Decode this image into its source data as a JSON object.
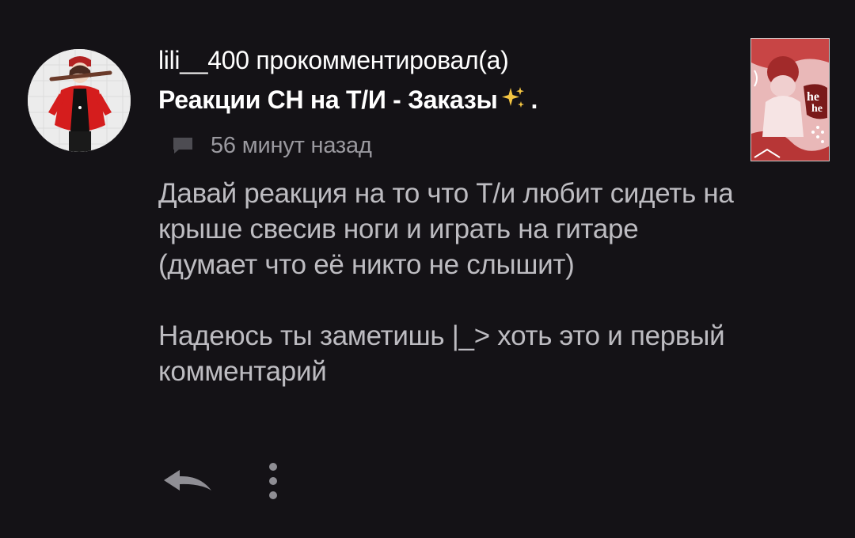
{
  "notification": {
    "username": "lili__400",
    "action_text": "прокомментировал(а)",
    "post_title": "Реакции СН на Т/И - Заказы",
    "title_suffix": ".",
    "time_ago": "56 минут назад",
    "comment_text": "Давай реакция на то что Т/и любит сидеть на крыше свесив ноги и играть на гитаре (думает что её никто не слышит)\n\nНадеюсь ты заметишь |_> хоть это и первый комментарий"
  },
  "thumbnail": {
    "lettering": "he he"
  },
  "icons": {
    "comment": "speech-bubble-icon",
    "reply": "reply-arrow-icon",
    "more": "vertical-dots-icon",
    "sparkles": "sparkles-emoji"
  },
  "colors": {
    "background": "#141216",
    "primary_text": "#ffffff",
    "secondary_text": "#9a999f",
    "body_text": "#bdbcc1",
    "icon": "#9a999f",
    "sparkles": "#f4c542"
  }
}
